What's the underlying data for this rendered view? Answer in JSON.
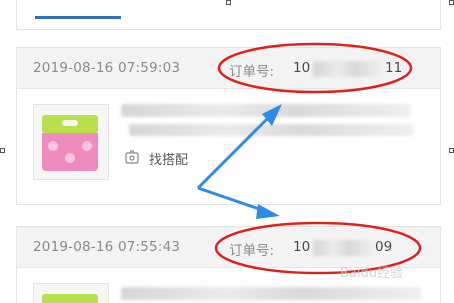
{
  "orders": [
    {
      "date": "2019-08-16 07:59:03",
      "order_label": "订单号:",
      "order_prefix": "10",
      "order_suffix": "11",
      "action": "找搭配"
    },
    {
      "date": "2019-08-16 07:55:43",
      "order_label": "订单号:",
      "order_prefix": "10",
      "order_suffix": "09"
    }
  ],
  "watermark": "Baidu经验",
  "colors": {
    "annotation_ellipse": "#e02020",
    "annotation_arrow": "#2f8be6",
    "header_bg": "#f3f3f3",
    "tab_underline": "#2f6fc8"
  },
  "icons": {
    "match": "hanger-tag-icon"
  }
}
